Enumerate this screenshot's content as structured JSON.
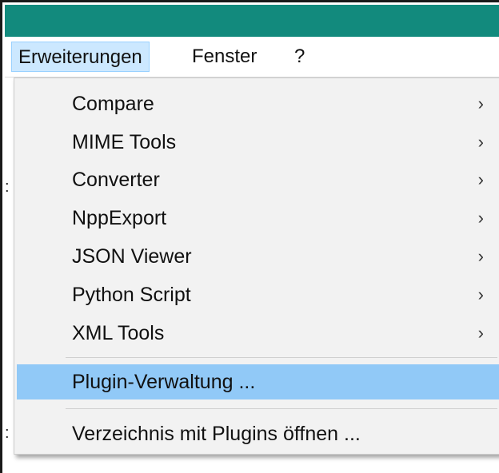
{
  "menubar": {
    "items": [
      {
        "label": "Erweiterungen"
      },
      {
        "label": "Fenster"
      },
      {
        "label": "?"
      }
    ]
  },
  "dropdown": {
    "items": [
      {
        "label": "Compare",
        "submenu": true
      },
      {
        "label": "MIME Tools",
        "submenu": true
      },
      {
        "label": "Converter",
        "submenu": true
      },
      {
        "label": "NppExport",
        "submenu": true
      },
      {
        "label": "JSON Viewer",
        "submenu": true
      },
      {
        "label": "Python Script",
        "submenu": true
      },
      {
        "label": "XML Tools",
        "submenu": true
      }
    ],
    "plugin_admin": {
      "label": "Plugin-Verwaltung ..."
    },
    "open_plugins_folder": {
      "label": "Verzeichnis mit Plugins öffnen ..."
    },
    "chevron_glyph": "›"
  },
  "colors": {
    "titlebar": "#128a7d",
    "highlight": "#91c9f7",
    "menubar_active": "#cce8ff"
  }
}
